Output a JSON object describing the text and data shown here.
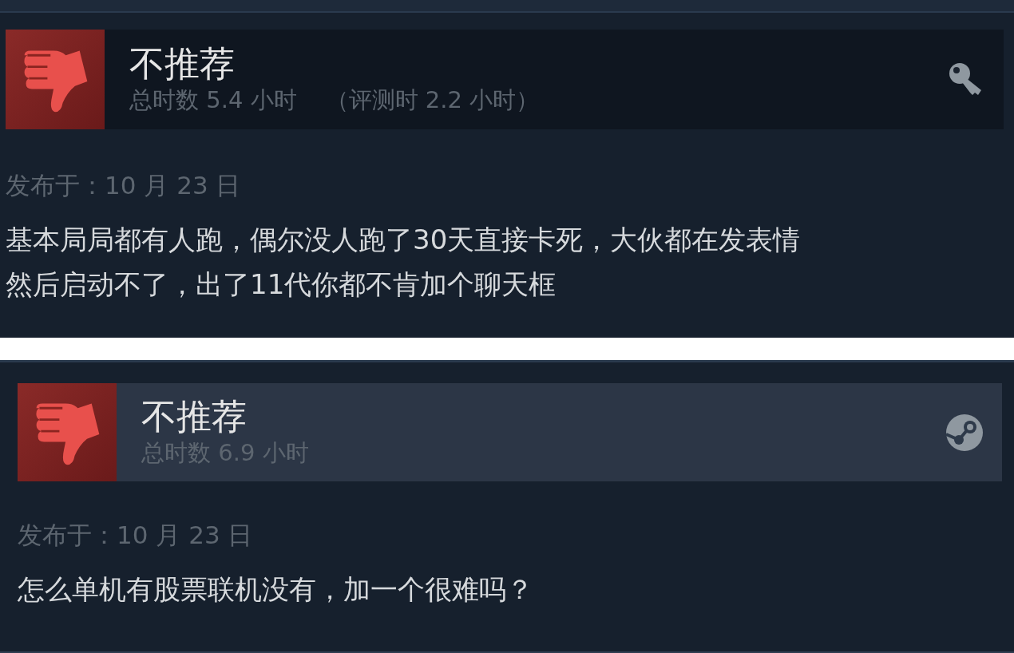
{
  "reviews": [
    {
      "recommended": false,
      "verdict": "不推荐",
      "hours": "总时数 5.4 小时",
      "review_hours": "（评测时 2.2 小时）",
      "kind": "key",
      "posted": "发布于：10 月 23 日",
      "text_lines": [
        "基本局局都有人跑，偶尔没人跑了30天直接卡死，大伙都在发表情",
        "然后启动不了，出了11代你都不肯加个聊天框"
      ]
    },
    {
      "recommended": false,
      "verdict": "不推荐",
      "hours": "总时数 6.9 小时",
      "kind": "steam",
      "posted": "发布于：10 月 23 日",
      "text_lines": [
        "怎么单机有股票联机没有，加一个很难吗？"
      ]
    }
  ]
}
